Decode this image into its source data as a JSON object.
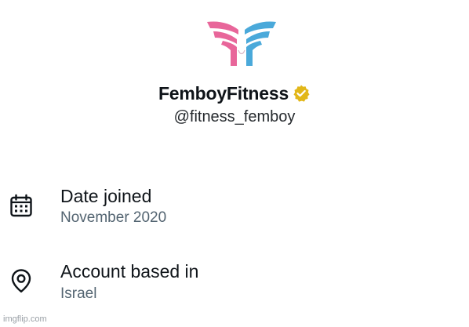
{
  "profile": {
    "display_name": "FemboyFitness",
    "handle": "@fitness_femboy",
    "logo_icon": "femboy-fitness-wings-logo",
    "verified_icon": "verified-badge-icon",
    "colors": {
      "logo_pink": "#e8669a",
      "logo_blue": "#4aa9da",
      "verified_gold": "#e2b719"
    }
  },
  "about": {
    "date_joined": {
      "icon": "calendar-icon",
      "title": "Date joined",
      "value": "November 2020"
    },
    "location": {
      "icon": "location-pin-icon",
      "title": "Account based in",
      "value": "Israel"
    }
  },
  "watermark": "imgflip.com"
}
